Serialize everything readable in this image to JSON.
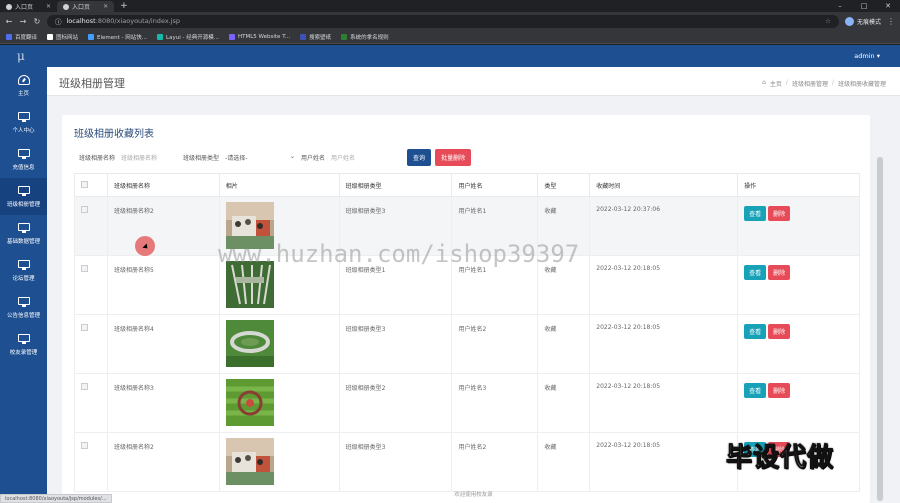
{
  "browser": {
    "tabs": [
      {
        "label": "入口页",
        "active": false
      },
      {
        "label": "入口页",
        "active": true
      }
    ],
    "url_host": "localhost",
    "url_port_path": ":8080/xiaoyouta/index.jsp",
    "profile_label": "无痕模式",
    "bookmarks": [
      {
        "label": "百度翻译",
        "color": "#4e6ef2"
      },
      {
        "label": "图标网站",
        "color": "#ffffff"
      },
      {
        "label": "Element - 网站快...",
        "color": "#409eff"
      },
      {
        "label": "Layui - 经典开源模...",
        "color": "#16baaa"
      },
      {
        "label": "HTML5 Website T...",
        "color": "#7b61ff"
      },
      {
        "label": "搜索壁纸",
        "color": "#3f51b5"
      },
      {
        "label": "系统的拿名规则",
        "color": "#2e7d32"
      }
    ]
  },
  "app": {
    "logo": "μ",
    "user": "admin ▾",
    "sidebar": [
      {
        "label": "主页",
        "icon": "gauge-icon"
      },
      {
        "label": "个人中心",
        "icon": "monitor-icon"
      },
      {
        "label": "充值信息",
        "icon": "monitor-icon"
      },
      {
        "label": "班级相册管理",
        "icon": "monitor-icon"
      },
      {
        "label": "基础数据管理",
        "icon": "monitor-icon"
      },
      {
        "label": "论坛管理",
        "icon": "monitor-icon"
      },
      {
        "label": "公告信息管理",
        "icon": "monitor-icon"
      },
      {
        "label": "校友录管理",
        "icon": "monitor-icon"
      }
    ],
    "page_title": "班级相册管理",
    "breadcrumbs": [
      "主页",
      "班级相册管理",
      "班级相册收藏管理"
    ],
    "card_title": "班级相册收藏列表",
    "filters": {
      "name_label": "班级相册名称",
      "name_placeholder": "班级相册名称",
      "type_label": "班级相册类型",
      "type_value": "-请选择-",
      "user_label": "用户姓名",
      "user_placeholder": "用户姓名",
      "query_btn": "查询",
      "batch_delete_btn": "批量删除"
    },
    "table": {
      "headers": [
        "班级相册名称",
        "相片",
        "班级相册类型",
        "用户姓名",
        "类型",
        "收藏时间",
        "操作"
      ],
      "rows": [
        {
          "name": "班级相册名称2",
          "photo": "class-photo-indoor",
          "type": "班级相册类型3",
          "user": "用户姓名1",
          "kind": "收藏",
          "time": "2022-03-12 20:37:06"
        },
        {
          "name": "班级相册名称5",
          "photo": "class-photo-field-lines",
          "type": "班级相册类型1",
          "user": "用户姓名1",
          "kind": "收藏",
          "time": "2022-03-12 20:18:05"
        },
        {
          "name": "班级相册名称4",
          "photo": "class-photo-circle",
          "type": "班级相册类型3",
          "user": "用户姓名2",
          "kind": "收藏",
          "time": "2022-03-12 20:18:05"
        },
        {
          "name": "班级相册名称3",
          "photo": "class-photo-formation",
          "type": "班级相册类型2",
          "user": "用户姓名3",
          "kind": "收藏",
          "time": "2022-03-12 20:18:05"
        },
        {
          "name": "班级相册名称2",
          "photo": "class-photo-indoor",
          "type": "班级相册类型3",
          "user": "用户姓名2",
          "kind": "收藏",
          "time": "2022-03-12 20:18:05"
        }
      ],
      "view_label": "查看",
      "delete_label": "删除"
    },
    "footer": "欢迎使用校友录",
    "status_url": "localhost:8080/xiaoyouta/jsp/modules/..."
  },
  "overlay": {
    "watermark": "www.huzhan.com/ishop39397",
    "brand": "毕设代做"
  }
}
